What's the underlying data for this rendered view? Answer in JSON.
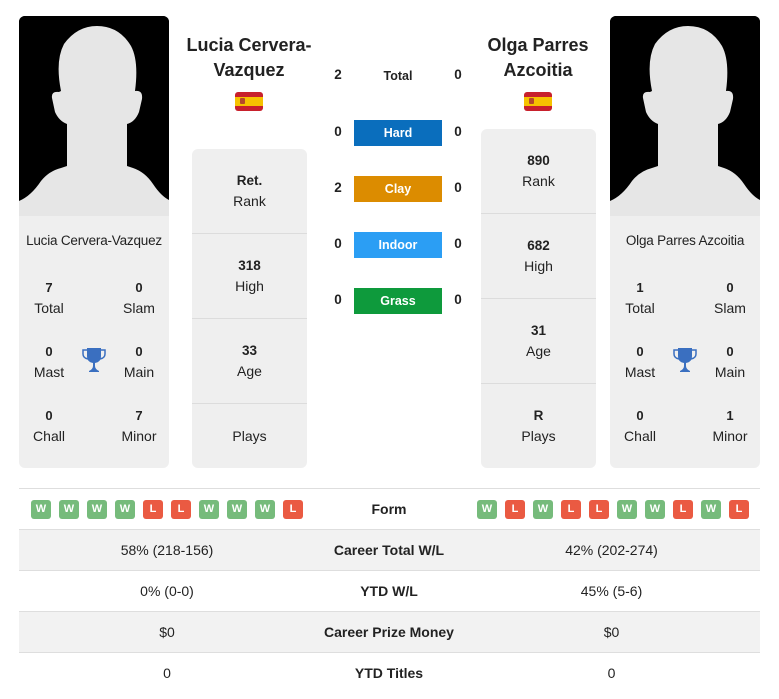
{
  "colors": {
    "hard": "#0a6ebd",
    "clay": "#dc8c00",
    "indoor": "#2b9ef4",
    "grass": "#0e9a3c",
    "win": "#76bb7b",
    "loss": "#ea5a42",
    "trophy": "#3a6fc0"
  },
  "player1": {
    "name": "Lucia Cervera-Vazquez",
    "name_line1": "Lucia Cervera-",
    "name_line2": "Vazquez",
    "country_flag": "spain-flag",
    "stats": [
      {
        "value": "Ret.",
        "label": "Rank"
      },
      {
        "value": "318",
        "label": "High"
      },
      {
        "value": "33",
        "label": "Age"
      },
      {
        "value": "",
        "label": "Plays"
      }
    ],
    "titles": {
      "total": {
        "value": "7",
        "label": "Total"
      },
      "slam": {
        "value": "0",
        "label": "Slam"
      },
      "mast": {
        "value": "0",
        "label": "Mast"
      },
      "main": {
        "value": "0",
        "label": "Main"
      },
      "chall": {
        "value": "0",
        "label": "Chall"
      },
      "minor": {
        "value": "7",
        "label": "Minor"
      }
    },
    "form": [
      "W",
      "W",
      "W",
      "W",
      "L",
      "L",
      "W",
      "W",
      "W",
      "L"
    ]
  },
  "player2": {
    "name": "Olga Parres Azcoitia",
    "name_line1": "Olga Parres",
    "name_line2": "Azcoitia",
    "country_flag": "spain-flag",
    "stats": [
      {
        "value": "890",
        "label": "Rank"
      },
      {
        "value": "682",
        "label": "High"
      },
      {
        "value": "31",
        "label": "Age"
      },
      {
        "value": "R",
        "label": "Plays"
      }
    ],
    "titles": {
      "total": {
        "value": "1",
        "label": "Total"
      },
      "slam": {
        "value": "0",
        "label": "Slam"
      },
      "mast": {
        "value": "0",
        "label": "Mast"
      },
      "main": {
        "value": "0",
        "label": "Main"
      },
      "chall": {
        "value": "0",
        "label": "Chall"
      },
      "minor": {
        "value": "1",
        "label": "Minor"
      }
    },
    "form": [
      "W",
      "L",
      "W",
      "L",
      "L",
      "W",
      "W",
      "L",
      "W",
      "L"
    ]
  },
  "h2h": [
    {
      "label": "Total",
      "left": "2",
      "right": "0",
      "surface": "total"
    },
    {
      "label": "Hard",
      "left": "0",
      "right": "0",
      "surface": "hard"
    },
    {
      "label": "Clay",
      "left": "2",
      "right": "0",
      "surface": "clay"
    },
    {
      "label": "Indoor",
      "left": "0",
      "right": "0",
      "surface": "indoor"
    },
    {
      "label": "Grass",
      "left": "0",
      "right": "0",
      "surface": "grass"
    }
  ],
  "comparison": [
    {
      "label": "Form"
    },
    {
      "label": "Career Total W/L",
      "left": "58% (218-156)",
      "right": "42% (202-274)"
    },
    {
      "label": "YTD W/L",
      "left": "0% (0-0)",
      "right": "45% (5-6)"
    },
    {
      "label": "Career Prize Money",
      "left": "$0",
      "right": "$0"
    },
    {
      "label": "YTD Titles",
      "left": "0",
      "right": "0"
    }
  ]
}
